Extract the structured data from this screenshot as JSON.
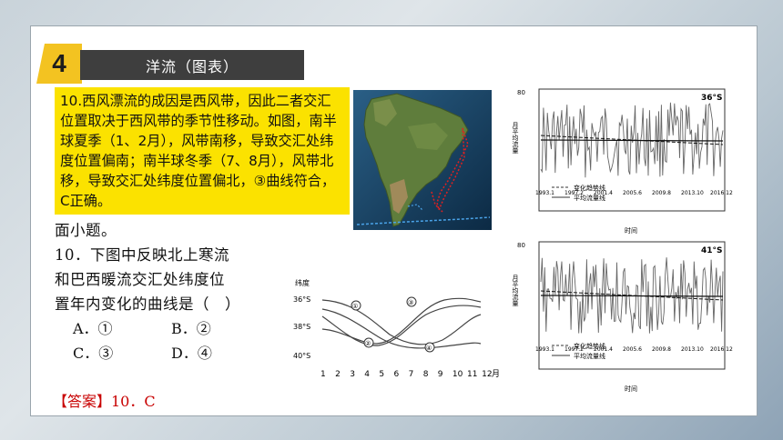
{
  "header": {
    "number": "4",
    "title": "洋流（图表）"
  },
  "explanation": "10.西风漂流的成因是西风带，因此二者交汇位置取决于西风带的季节性移动。如图，南半球夏季（1、2月），风带南移，导致交汇处纬度位置偏南；南半球冬季（7、8月），风带北移，导致交汇处纬度位置偏北，③曲线符合，C正确。",
  "question": {
    "intro_tail": "面小题。",
    "line1": "10．下图中反映北上寒流",
    "line2": "和巴西暖流交汇处纬度位",
    "line3": "置年内变化的曲线是（　）",
    "options": [
      {
        "a": "A．①",
        "b": "B．②"
      },
      {
        "a": "C．③",
        "b": "D．④"
      }
    ],
    "answer": "【答案】10．C"
  },
  "latitude_chart": {
    "ylabel": "纬度",
    "yticks": [
      "36°S",
      "38°S",
      "40°S"
    ],
    "xticks": [
      "1",
      "2",
      "3",
      "4",
      "5",
      "6",
      "7",
      "8",
      "9",
      "10",
      "11",
      "12"
    ],
    "xunit": "月",
    "curve_labels": [
      "①",
      "②",
      "③",
      "④"
    ]
  },
  "flow_chart_top": {
    "corner_label": "36°S",
    "ylabel": "月平均流量",
    "legend": [
      "变化趋势线",
      "平均流量线"
    ],
    "xticks": [
      "1993.1",
      "1997.2",
      "2001.4",
      "2005.6",
      "2009.8",
      "2013.10",
      "2016.12"
    ],
    "xlabel": "时间",
    "axis_top": "80"
  },
  "flow_chart_bottom": {
    "corner_label": "41°S",
    "ylabel": "月平均流量",
    "legend": [
      "变化趋势线",
      "平均流量线"
    ],
    "xticks": [
      "1993.1",
      "1997.2",
      "2001.4",
      "2005.6",
      "2009.8",
      "2013.10",
      "2016.12"
    ],
    "xlabel": "时间",
    "axis_top": "80"
  },
  "colors": {
    "accent_yellow": "#f3c321",
    "highlight": "#fbe200",
    "answer_red": "#c80000",
    "title_bar": "#3e3e3e"
  }
}
